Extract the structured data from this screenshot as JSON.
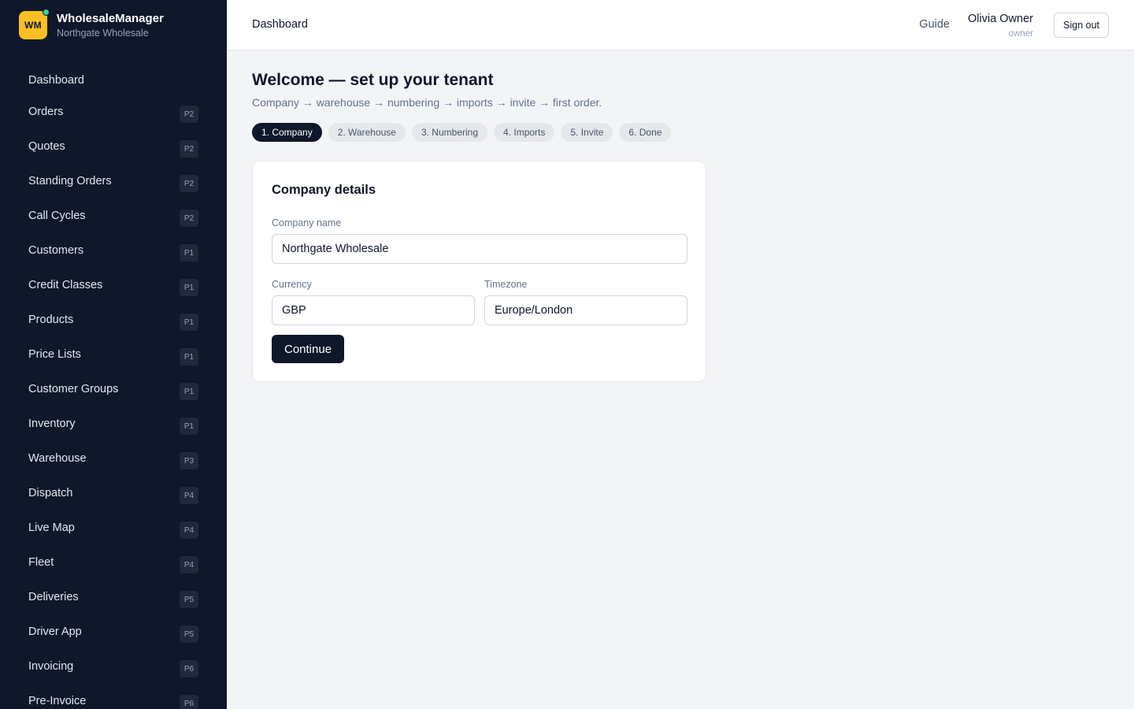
{
  "brand": {
    "logo_text": "WM",
    "name": "WholesaleManager",
    "tenant": "Northgate Wholesale",
    "logo_color": "#fbbf24",
    "status_dot_color": "#34d399"
  },
  "sidebar": {
    "items": [
      {
        "label": "Dashboard",
        "badge": ""
      },
      {
        "label": "Orders",
        "badge": "P2"
      },
      {
        "label": "Quotes",
        "badge": "P2"
      },
      {
        "label": "Standing Orders",
        "badge": "P2"
      },
      {
        "label": "Call Cycles",
        "badge": "P2"
      },
      {
        "label": "Customers",
        "badge": "P1"
      },
      {
        "label": "Credit Classes",
        "badge": "P1"
      },
      {
        "label": "Products",
        "badge": "P1"
      },
      {
        "label": "Price Lists",
        "badge": "P1"
      },
      {
        "label": "Customer Groups",
        "badge": "P1"
      },
      {
        "label": "Inventory",
        "badge": "P1"
      },
      {
        "label": "Warehouse",
        "badge": "P3"
      },
      {
        "label": "Dispatch",
        "badge": "P4"
      },
      {
        "label": "Live Map",
        "badge": "P4"
      },
      {
        "label": "Fleet",
        "badge": "P4"
      },
      {
        "label": "Deliveries",
        "badge": "P5"
      },
      {
        "label": "Driver App",
        "badge": "P5"
      },
      {
        "label": "Invoicing",
        "badge": "P6"
      },
      {
        "label": "Pre-Invoice",
        "badge": "P6"
      }
    ]
  },
  "header": {
    "title": "Dashboard",
    "guide_label": "Guide",
    "user_name": "Olivia Owner",
    "user_role": "owner",
    "signout_label": "Sign out"
  },
  "main": {
    "heading": "Welcome — set up your tenant",
    "subheading": "Company → warehouse → numbering → imports → invite → first order.",
    "steps": [
      {
        "label": "1. Company",
        "active": true
      },
      {
        "label": "2. Warehouse",
        "active": false
      },
      {
        "label": "3. Numbering",
        "active": false
      },
      {
        "label": "4. Imports",
        "active": false
      },
      {
        "label": "5. Invite",
        "active": false
      },
      {
        "label": "6. Done",
        "active": false
      }
    ],
    "card": {
      "title": "Company details",
      "company_name_label": "Company name",
      "company_name_value": "Northgate Wholesale",
      "currency_label": "Currency",
      "currency_value": "GBP",
      "timezone_label": "Timezone",
      "timezone_value": "Europe/London",
      "continue_label": "Continue"
    }
  }
}
